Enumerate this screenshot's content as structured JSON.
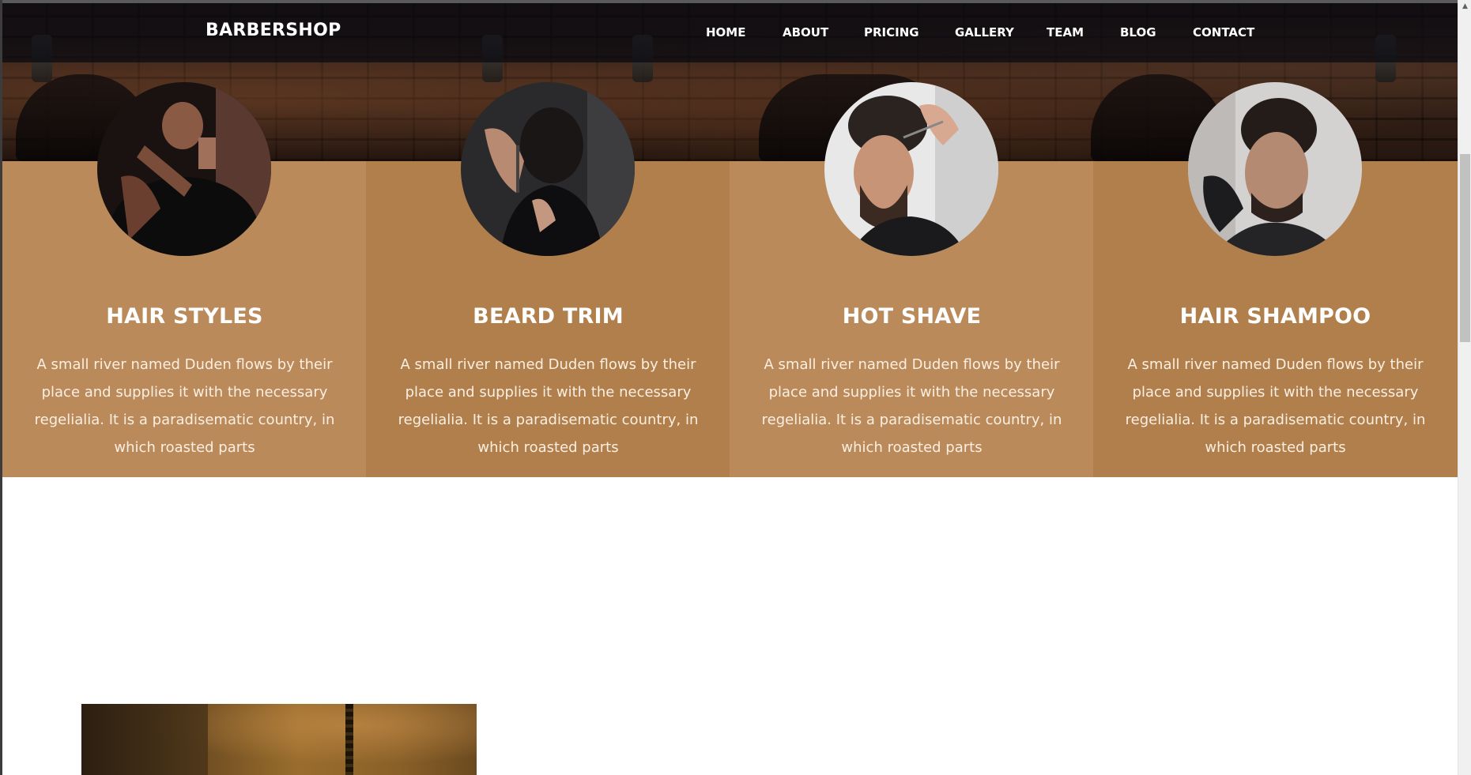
{
  "navbar": {
    "brand": "BARBERSHOP",
    "items": [
      "HOME",
      "ABOUT",
      "PRICING",
      "GALLERY",
      "TEAM",
      "BLOG",
      "CONTACT"
    ]
  },
  "services": [
    {
      "title": "HAIR STYLES",
      "text": "A small river named Duden flows by their place and supplies it with the necessary regelialia. It is a paradisematic country, in which roasted parts",
      "image": "man-shaving-beard-photo"
    },
    {
      "title": "BEARD TRIM",
      "text": "A small river named Duden flows by their place and supplies it with the necessary regelialia. It is a paradisematic country, in which roasted parts",
      "image": "barber-trimming-neck-photo"
    },
    {
      "title": "HOT SHAVE",
      "text": "A small river named Duden flows by their place and supplies it with the necessary regelialia. It is a paradisematic country, in which roasted parts",
      "image": "haircut-with-scissors-photo"
    },
    {
      "title": "HAIR SHAMPOO",
      "text": "A small river named Duden flows by their place and supplies it with the necessary regelialia. It is a paradisematic country, in which roasted parts",
      "image": "tattooed-man-haircut-photo"
    }
  ],
  "colors": {
    "card_light": "#bb8a5a",
    "card_dark": "#b17f4c",
    "navbar": "#080a10"
  },
  "scrollbar": {
    "up_arrow_icon": "▲"
  }
}
